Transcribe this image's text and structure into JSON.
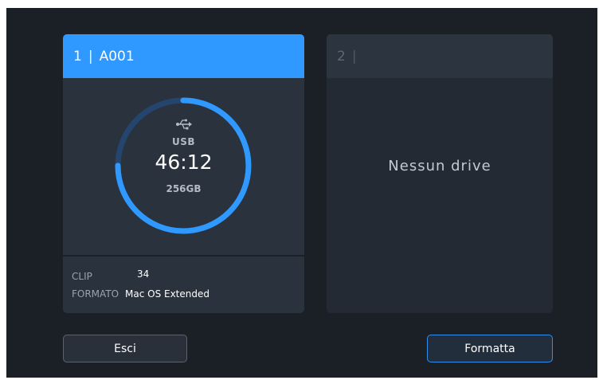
{
  "slot1": {
    "number": "1",
    "separator": "|",
    "clip_name": "A001",
    "media_icon": "usb-icon",
    "media_type": "USB",
    "remaining_time": "46:12",
    "capacity": "256GB",
    "used_fraction": 0.25,
    "clip_label": "CLIP",
    "clip_count": "34",
    "format_label": "FORMATO",
    "format_value": "Mac OS Extended"
  },
  "slot2": {
    "number": "2",
    "separator": "|",
    "empty_message": "Nessun drive"
  },
  "buttons": {
    "exit": "Esci",
    "format": "Formatta"
  },
  "colors": {
    "accent": "#2f99ff",
    "background": "#1b1f26",
    "card": "#2a323e",
    "ring_track": "#24466e"
  }
}
